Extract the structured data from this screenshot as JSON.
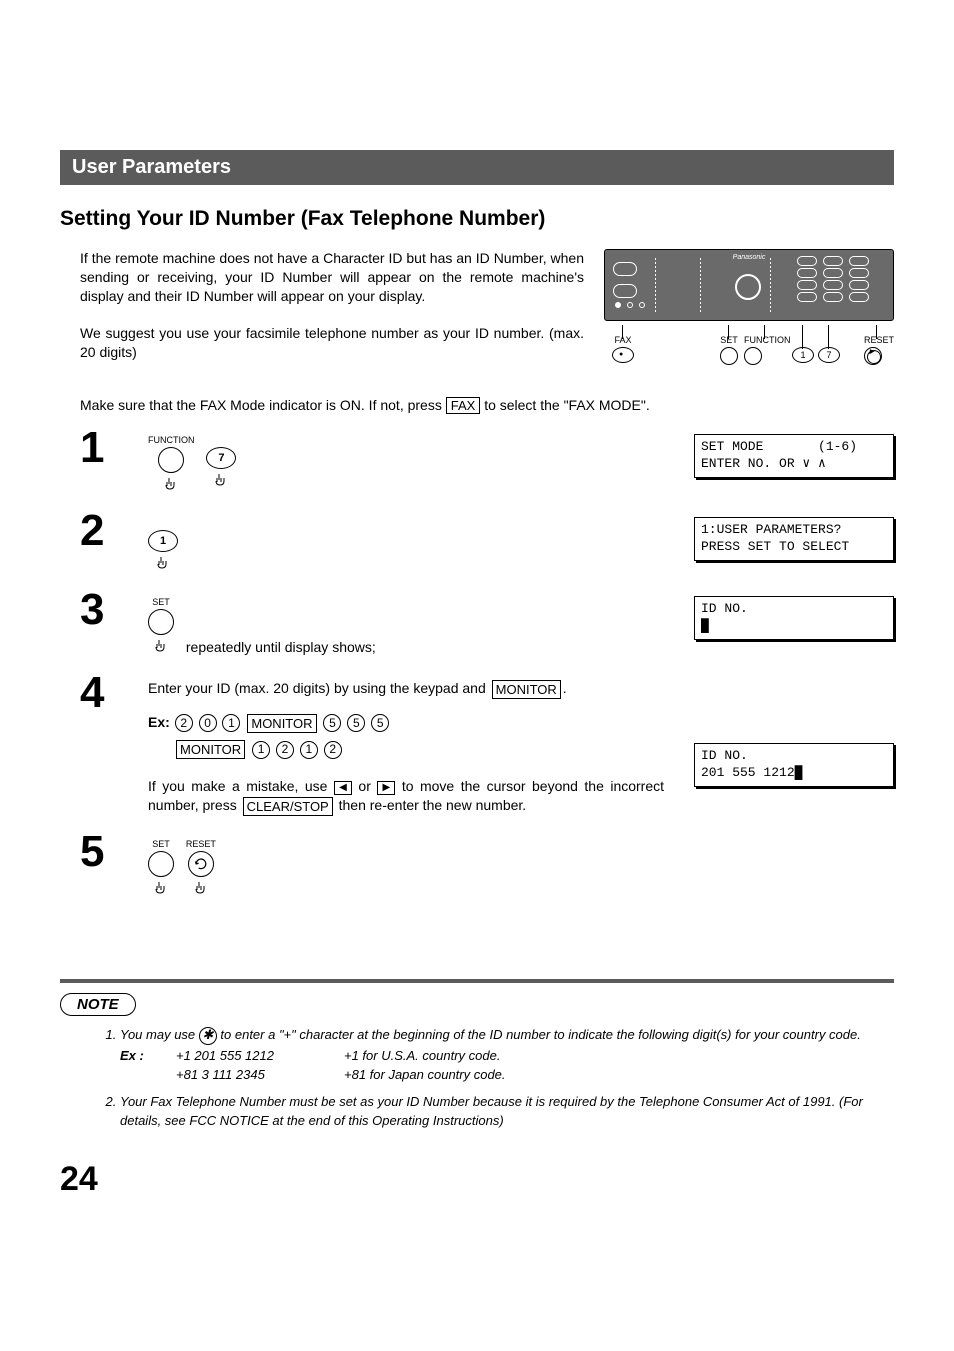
{
  "section_title": "User Parameters",
  "subheading": "Setting Your ID Number (Fax Telephone Number)",
  "intro": {
    "p1": "If the remote machine does not have a Character ID but has an ID Number, when sending or receiving, your ID Number will appear on the remote machine's display and their ID Number will appear on your display.",
    "p2": "We suggest you use your facsimile telephone number as your ID number. (max. 20 digits)"
  },
  "panel_brand": "Panasonic",
  "callouts": {
    "fax": "FAX",
    "set": "SET",
    "function": "FUNCTION",
    "one": "1",
    "seven": "7",
    "reset": "RESET"
  },
  "prestep": {
    "prefix": "Make sure that the FAX Mode indicator is ON.  If not, press ",
    "key": "FAX",
    "suffix": " to select the \"FAX MODE\"."
  },
  "steps": {
    "1": {
      "func_label": "FUNCTION",
      "seven": "7",
      "lcd": "SET MODE       (1-6)\nENTER NO. OR ∨ ∧"
    },
    "2": {
      "one": "1",
      "lcd": "1:USER PARAMETERS?\nPRESS SET TO SELECT"
    },
    "3": {
      "set_label": "SET",
      "text_after": " repeatedly until display shows;",
      "lcd": "ID NO.\n█"
    },
    "4": {
      "p1_prefix": "Enter your ID (max. 20 digits) by using the keypad and ",
      "monitor": "MONITOR",
      "period": ".",
      "ex_label": "Ex:",
      "digits1": [
        "2",
        "0",
        "1"
      ],
      "digits2": [
        "5",
        "5",
        "5"
      ],
      "digits3": [
        "1",
        "2",
        "1",
        "2"
      ],
      "p2_prefix": "If you make a mistake, use ",
      "arrow_left": "◀",
      "or": " or ",
      "arrow_right": "▶",
      "p2_mid": " to move the cursor beyond the incorrect number, press ",
      "clear_stop": "CLEAR/STOP",
      "p2_suffix": " then re-enter the new number.",
      "lcd": "ID NO.\n201 555 1212█"
    },
    "5": {
      "set_label": "SET",
      "reset_label": "RESET"
    }
  },
  "note": {
    "badge": "NOTE",
    "n1_prefix": "You may use ",
    "star": "✱",
    "n1_suffix": " to enter a \"+\" character at the beginning of the ID number to indicate the following digit(s) for your country code.",
    "ex_label": "Ex :",
    "ex1_num": "+1 201 555 1212",
    "ex1_desc": "+1 for U.S.A. country code.",
    "ex2_num": "+81 3 111 2345",
    "ex2_desc": "+81 for Japan country code.",
    "n2": "Your Fax Telephone Number must be set as your ID Number because it is required by the Telephone Consumer Act of 1991. (For details, see FCC NOTICE at the end of this Operating Instructions)"
  },
  "page_number": "24"
}
